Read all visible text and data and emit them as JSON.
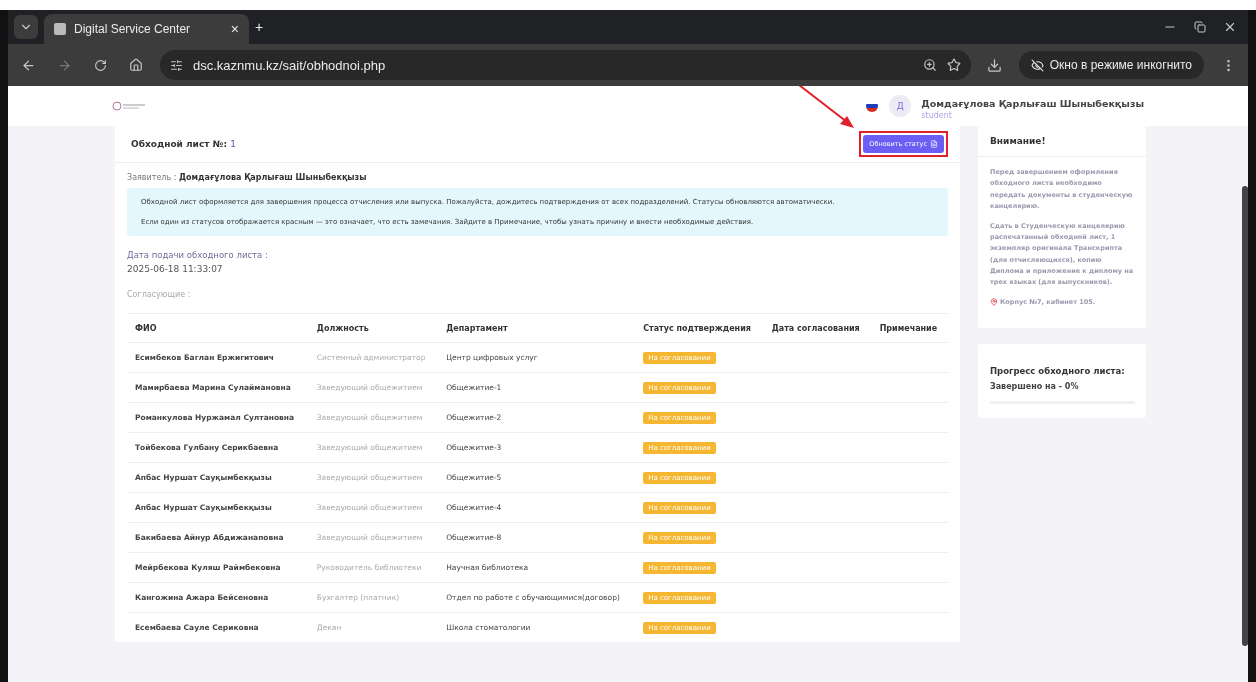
{
  "browser": {
    "tab_title": "Digital Service Center",
    "tab_close": "×",
    "new_tab": "+",
    "url": "dsc.kaznmu.kz/sait/obhodnoi.php",
    "incognito": "Окно в режиме инкогнито"
  },
  "header": {
    "user_name": "Домдағұлова Қарлығаш Шыныбекқызы",
    "user_role": "student",
    "avatar_letter": "Д"
  },
  "sheet": {
    "title": "Обходной лист №:",
    "number": "1",
    "update_button": "Обновить статус",
    "applicant_label": "Заявитель :",
    "applicant": "Домдағұлова Қарлығаш Шыныбекқызы",
    "notice": [
      "Обходной лист оформляется для завершения процесса отчисления или выпуска. Пожалуйста, дождитесь подтверждения от всех подразделений. Статусы обновляются автоматически.",
      "Если один из статусов отображается красным — это означает, что есть замечания. Зайдите в Примечание, чтобы узнать причину и внести необходимые действия."
    ],
    "date_label": "Дата подачи обходного листа :",
    "date": "2025-06-18 11:33:07",
    "approvers_label": "Согласующие :"
  },
  "table": {
    "columns": [
      "ФИО",
      "Должность",
      "Департамент",
      "Статус подтверждения",
      "Дата согласования",
      "Примечание"
    ],
    "rows": [
      {
        "name": "Есимбеков Баглан Ержигитович",
        "position": "Системный администратор",
        "department": "Центр цифровых услуг",
        "status": "На согласовании",
        "color": "#f5b731"
      },
      {
        "name": "Мамирбаева Марина Сулаймановна",
        "position": "Заведующий общежитием",
        "department": "Общежитие-1",
        "status": "На согласовании",
        "color": "#f5b731"
      },
      {
        "name": "Романкулова Нуржамал Султановна",
        "position": "Заведующий общежитием",
        "department": "Общежитие-2",
        "status": "На согласовании",
        "color": "#f5b731"
      },
      {
        "name": "Тойбекова Гулбану Серикбаевна",
        "position": "Заведующий общежитием",
        "department": "Общежитие-3",
        "status": "На согласовании",
        "color": "#f5b731"
      },
      {
        "name": "Апбас Нуршат Сауқымбекқызы",
        "position": "Заведующий общежитием",
        "department": "Общежитие-5",
        "status": "На согласовании",
        "color": "#f5b731"
      },
      {
        "name": "Апбас Нуршат Сауқымбекқызы",
        "position": "Заведующий общежитием",
        "department": "Общежитие-4",
        "status": "На согласовании",
        "color": "#f5b731"
      },
      {
        "name": "Бакибаева Айнур Абдижанаповна",
        "position": "Заведующий общежитием",
        "department": "Общежитие-8",
        "status": "На согласовании",
        "color": "#f5b731"
      },
      {
        "name": "Мейрбекова Куляш Раймбековна",
        "position": "Руководитель библиотеки",
        "department": "Научная библиотека",
        "status": "На согласовании",
        "color": "#f5b731"
      },
      {
        "name": "Кангожина Ажара Бейсеновна",
        "position": "Бухгалтер (платник)",
        "department": "Отдел по работе с обучающимися(договор)",
        "status": "На согласовании",
        "color": "#f5b731"
      },
      {
        "name": "Есембаева Сауле Сериковна",
        "position": "Декан",
        "department": "Школа стоматологии",
        "status": "На согласовании",
        "color": "#f5b731"
      }
    ]
  },
  "attention": {
    "title": "Внимание!",
    "paragraphs": [
      "Перед завершением оформления обходного листа необходимо передать документы в студенческую канцелярию.",
      "Сдать в Студенческую канцелярию распечатанный обходной лист, 1 экземпляр оригинала Транскрипта (для отчисляющихся), копию Диплома и приложение к диплому на трех языках (для выпускников)."
    ],
    "location": "Корпус №7, кабинет 105."
  },
  "progress": {
    "title": "Прогресс обходного листа:",
    "label": "Завершено на - 0%",
    "level": 0
  }
}
